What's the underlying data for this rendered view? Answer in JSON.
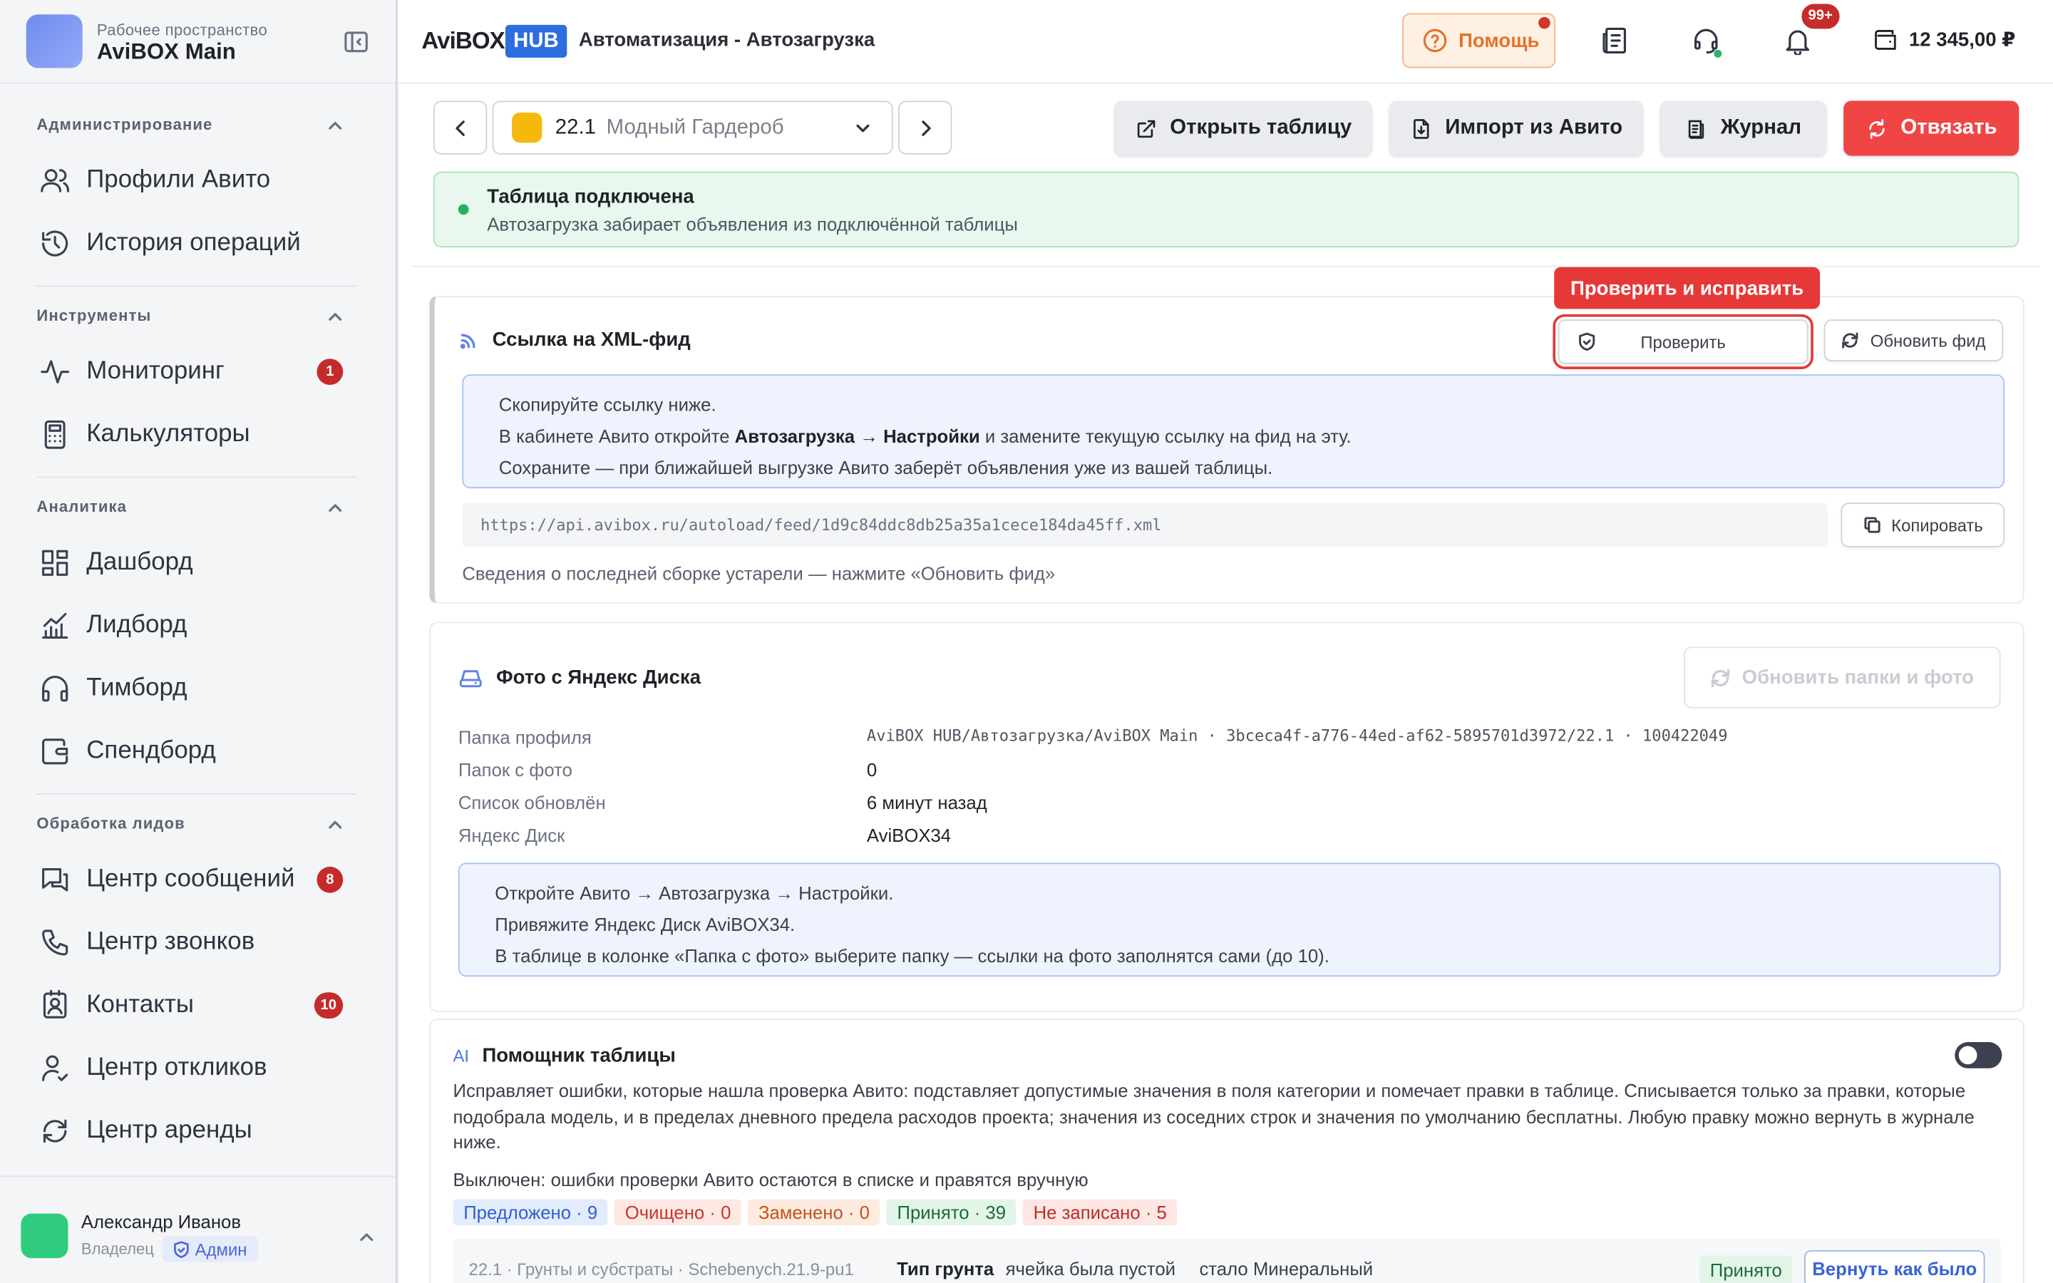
{
  "workspace": {
    "subtitle": "Рабочее пространство",
    "name": "AviBOX Main"
  },
  "sidebar": {
    "sections": [
      {
        "title": "Администрирование",
        "items": [
          {
            "label": "Профили Авито",
            "icon": "users-icon"
          },
          {
            "label": "История операций",
            "icon": "history-icon"
          }
        ]
      },
      {
        "title": "Инструменты",
        "items": [
          {
            "label": "Мониторинг",
            "icon": "activity-icon",
            "badge": "1"
          },
          {
            "label": "Калькуляторы",
            "icon": "calculator-icon"
          }
        ]
      },
      {
        "title": "Аналитика",
        "items": [
          {
            "label": "Дашборд",
            "icon": "dashboard-icon"
          },
          {
            "label": "Лидборд",
            "icon": "chart-icon"
          },
          {
            "label": "Тимборд",
            "icon": "headphones-icon"
          },
          {
            "label": "Спендборд",
            "icon": "wallet-icon"
          }
        ]
      },
      {
        "title": "Обработка лидов",
        "items": [
          {
            "label": "Центр сообщений",
            "icon": "messages-icon",
            "badge": "8"
          },
          {
            "label": "Центр звонков",
            "icon": "phone-icon"
          },
          {
            "label": "Контакты",
            "icon": "contacts-icon",
            "badge": "10"
          },
          {
            "label": "Центр откликов",
            "icon": "user-check-icon"
          },
          {
            "label": "Центр аренды",
            "icon": "refresh-icon"
          }
        ]
      }
    ],
    "user": {
      "name": "Александр Иванов",
      "role": "Владелец",
      "badge": "Админ"
    }
  },
  "topbar": {
    "brand": "AviBOX",
    "brand_hub": "HUB",
    "breadcrumb": "Автоматизация - Автозагрузка",
    "help_label": "Помощь",
    "notifications_badge": "99+",
    "balance": "12 345,00 ₽"
  },
  "toolbar": {
    "profile_num": "22.1",
    "profile_name": "Модный Гардероб",
    "open_table": "Открыть таблицу",
    "import": "Импорт из Авито",
    "journal": "Журнал",
    "unlink": "Отвязать"
  },
  "status": {
    "title": "Таблица подключена",
    "text": "Автозагрузка забирает объявления из подключённой таблицы"
  },
  "feed": {
    "title": "Ссылка на XML-фид",
    "tooltip": "Проверить и исправить",
    "check_label": "Проверить",
    "refresh_label": "Обновить фид",
    "info_line1": "Скопируйте ссылку ниже.",
    "info_line2_a": "В кабинете Авито откройте ",
    "info_line2_b": "Автозагрузка → Настройки",
    "info_line2_c": " и замените текущую ссылку на фид на эту.",
    "info_line3": "Сохраните — при ближайшей выгрузке Авито заберёт объявления уже из вашей таблицы.",
    "url": "https://api.avibox.ru/autoload/feed/1d9c84ddc8db25a35a1cece184da45ff.xml",
    "copy_label": "Копировать",
    "note": "Сведения о последней сборке устарели — нажмите «Обновить фид»"
  },
  "photos": {
    "title": "Фото с Яндекс Диска",
    "refresh_label": "Обновить папки и фото",
    "rows": [
      {
        "key": "Папка профиля",
        "value": "AviBOX HUB/Автозагрузка/AviBOX Main · 3bceca4f-a776-44ed-af62-5895701d3972/22.1 · 100422049"
      },
      {
        "key": "Папок с фото",
        "value": "0"
      },
      {
        "key": "Список обновлён",
        "value": "6 минут назад"
      },
      {
        "key": "Яндекс Диск",
        "value": "AviBOX34"
      }
    ],
    "info_line1": "Откройте Авито → Автозагрузка → Настройки.",
    "info_line2": "Привяжите Яндекс Диск AviBOX34.",
    "info_line3": "В таблице в колонке «Папка с фото» выберите папку — ссылки на фото заполнятся сами (до 10)."
  },
  "assistant": {
    "ai_label": "AI",
    "title": "Помощник таблицы",
    "description": "Исправляет ошибки, которые нашла проверка Авито: подставляет допустимые значения в поля категории и помечает правки в таблице. Списывается только за правки, которые подобрала модель, и в пределах дневного предела расходов проекта; значения из соседних строк и значения по умолчанию бесплатны. Любую правку можно вернуть в журнале ниже.",
    "state_text": "Выключен: ошибки проверки Авито остаются в списке и правятся вручную",
    "chips": [
      {
        "label": "Предложено · 9",
        "bg": "#e3ecfd",
        "fg": "#2f5fcf"
      },
      {
        "label": "Очищено · 0",
        "bg": "#fde8e3",
        "fg": "#c7372c"
      },
      {
        "label": "Заменено · 0",
        "bg": "#fdebdf",
        "fg": "#c2531e"
      },
      {
        "label": "Принято · 39",
        "bg": "#e2f5e8",
        "fg": "#1c6b38"
      },
      {
        "label": "Не записано · 5",
        "bg": "#fde6e4",
        "fg": "#b82f27"
      }
    ],
    "row": {
      "path": "22.1 · Грунты и субстраты · Schebenych.21.9-pu1",
      "field": "Тип грунта",
      "was": "ячейка была пустой",
      "became": "стало Минеральный",
      "status": "Принято",
      "revert": "Вернуть как было"
    }
  }
}
